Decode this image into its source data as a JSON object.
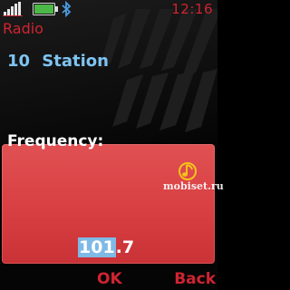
{
  "status": {
    "time": "12:16",
    "signal_icon": "signal-icon",
    "battery_icon": "battery-icon",
    "bluetooth_icon": "bluetooth-icon"
  },
  "app": {
    "title": "Radio"
  },
  "station": {
    "number": "10",
    "name": "Station"
  },
  "dialog": {
    "title": "Frequency:",
    "icon": "radio-note-icon",
    "value_selected": "101",
    "value_rest": ".7"
  },
  "watermark": "mobiset.ru",
  "softkeys": {
    "left": "OK",
    "right": "Back"
  },
  "colors": {
    "accent": "#cf2430",
    "station": "#7ec4f2",
    "dialog": "#d94245",
    "selection": "#7fb9e6"
  }
}
